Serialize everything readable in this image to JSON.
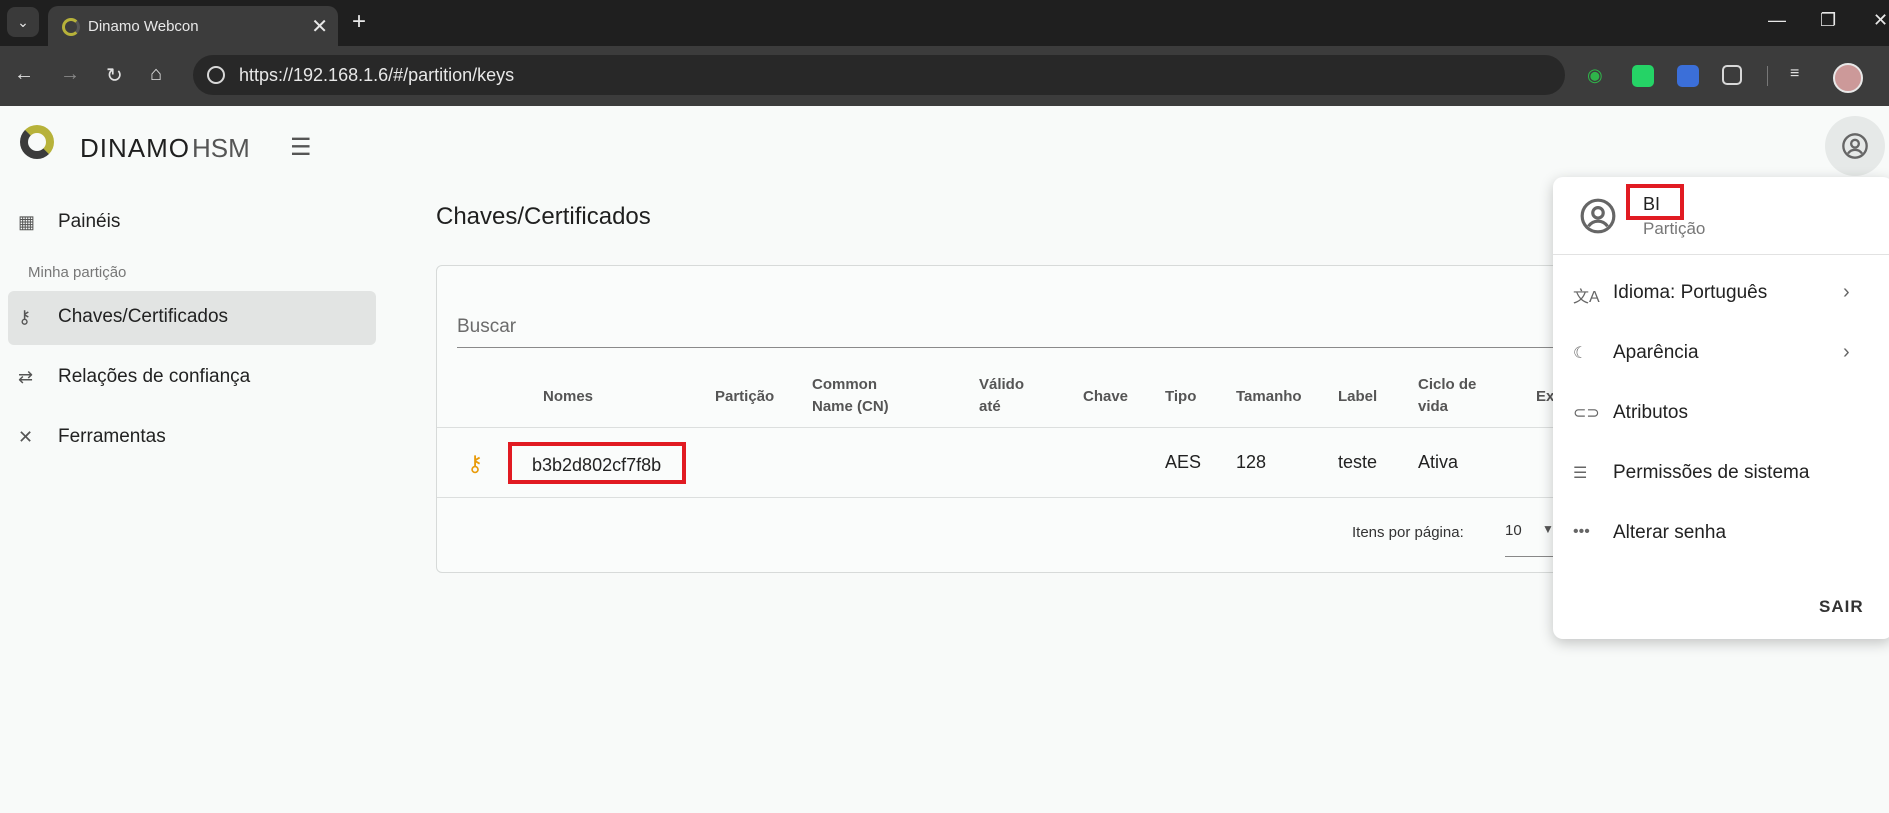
{
  "browser": {
    "tab_title": "Dinamo Webcon",
    "tab_close": "✕",
    "new_tab": "+",
    "url": "https://192.168.1.6/#/partition/keys",
    "window_controls": [
      "—",
      "❐",
      "✕"
    ]
  },
  "header": {
    "brand": "DINAMO",
    "brand_sub": "HSM"
  },
  "sidebar": {
    "section_label": "Minha partição",
    "items": [
      {
        "label": "Painéis",
        "icon": "dashboard-icon"
      },
      {
        "label": "Chaves/Certificados",
        "icon": "key-icon",
        "active": true
      },
      {
        "label": "Relações de confiança",
        "icon": "handshake-icon"
      },
      {
        "label": "Ferramentas",
        "icon": "tools-icon"
      }
    ]
  },
  "main": {
    "title": "Chaves/Certificados",
    "search_label": "Buscar",
    "columns": [
      "Nomes",
      "Partição",
      "Common Name (CN)",
      "Válido até",
      "Chave",
      "Tipo",
      "Tamanho",
      "Label",
      "Ciclo de vida",
      "Ex"
    ],
    "rows": [
      {
        "name": "b3b2d802cf7f8b",
        "particao": "",
        "cn": "",
        "valido": "",
        "chave": "",
        "tipo": "AES",
        "tamanho": "128",
        "label": "teste",
        "ciclo": "Ativa"
      }
    ],
    "pagination": {
      "label": "Itens por página:",
      "value": "10"
    }
  },
  "profile_menu": {
    "user_name": "BI",
    "user_role": "Partição",
    "items": [
      {
        "label": "Idioma: Português",
        "icon": "translate-icon",
        "has_submenu": true
      },
      {
        "label": "Aparência",
        "icon": "moon-icon",
        "has_submenu": true
      },
      {
        "label": "Atributos",
        "icon": "link-icon",
        "has_submenu": false
      },
      {
        "label": "Permissões de sistema",
        "icon": "checklist-icon",
        "has_submenu": false
      },
      {
        "label": "Alterar senha",
        "icon": "password-icon",
        "has_submenu": false
      }
    ],
    "logout": "SAIR"
  },
  "colors": {
    "accent_gold": "#b7b23a",
    "key_icon": "#e89b0a",
    "highlight_red": "#e11b22"
  }
}
